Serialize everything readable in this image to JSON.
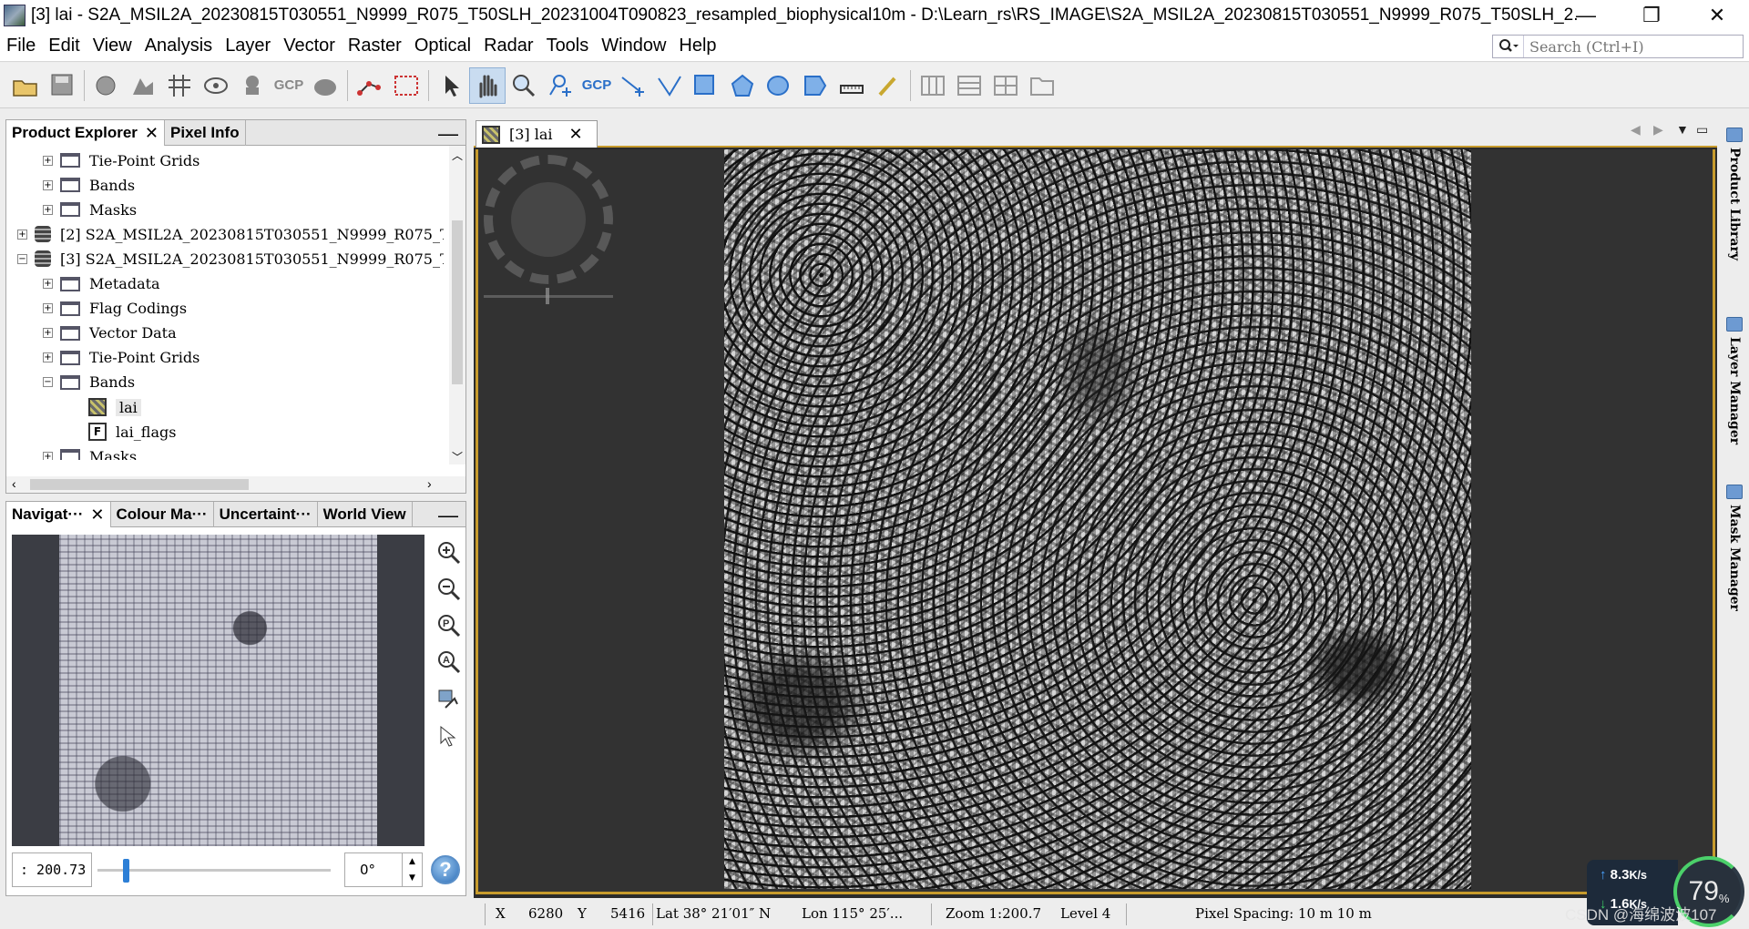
{
  "window": {
    "title": "[3] lai - S2A_MSIL2A_20230815T030551_N9999_R075_T50SLH_20231004T090823_resampled_biophysical10m - D:\\Learn_rs\\RS_IMAGE\\S2A_MSIL2A_20230815T030551_N9999_R075_T50SLH_2...",
    "minimize": "—",
    "restore": "❐",
    "close": "✕"
  },
  "menu": {
    "items": [
      "File",
      "Edit",
      "View",
      "Analysis",
      "Layer",
      "Vector",
      "Raster",
      "Optical",
      "Radar",
      "Tools",
      "Window",
      "Help"
    ],
    "search_placeholder": "Search (Ctrl+I)"
  },
  "toolbar": {
    "gcp_label": "GCP",
    "icons": [
      "open-product-icon",
      "save-product-icon",
      "band-maths-icon",
      "subset-icon",
      "graticule-icon",
      "world-map-icon",
      "gcp-icon",
      "pin-icon",
      "spectrum-icon",
      "pixel-info-icon",
      "select-tool-icon",
      "pan-tool-icon",
      "zoom-tool-icon",
      "pin-placing-icon",
      "gcp-placing-icon",
      "line-drawing-icon",
      "polyline-drawing-icon",
      "rectangle-drawing-icon",
      "polygon-drawing-icon",
      "ellipse-drawing-icon",
      "magic-wand-icon",
      "range-finder-icon",
      "pointer-icon",
      "tile-evenly-icon",
      "tile-horizontal-icon",
      "tile-vertical-icon",
      "tile-single-icon"
    ]
  },
  "product_explorer": {
    "tabs": [
      "Product Explorer",
      "Pixel Info"
    ],
    "minimize": "—",
    "rows": [
      {
        "label": "Tie-Point Grids",
        "exp": "+",
        "kind": "folder"
      },
      {
        "label": "Bands",
        "exp": "+",
        "kind": "folder"
      },
      {
        "label": "Masks",
        "exp": "+",
        "kind": "folder"
      },
      {
        "label": "[2]  S2A_MSIL2A_20230815T030551_N9999_R075_T50S",
        "exp": "+",
        "kind": "product"
      },
      {
        "label": "[3]  S2A_MSIL2A_20230815T030551_N9999_R075_T50S",
        "exp": "−",
        "kind": "product"
      },
      {
        "label": "Metadata",
        "exp": "+",
        "kind": "folder"
      },
      {
        "label": "Flag Codings",
        "exp": "+",
        "kind": "folder"
      },
      {
        "label": "Vector Data",
        "exp": "+",
        "kind": "folder"
      },
      {
        "label": "Tie-Point Grids",
        "exp": "+",
        "kind": "folder"
      },
      {
        "label": "Bands",
        "exp": "−",
        "kind": "folder"
      },
      {
        "label": "lai",
        "exp": "",
        "kind": "band"
      },
      {
        "label": "lai_flags",
        "exp": "",
        "kind": "flag"
      },
      {
        "label": "Masks",
        "exp": "+",
        "kind": "folder"
      }
    ]
  },
  "navigation": {
    "tabs": [
      "Navigat···",
      "Colour Ma···",
      "Uncertaint···",
      "World View"
    ],
    "zoom_value": ": 200.73",
    "rotation_value": "0°",
    "help": "?"
  },
  "image_view": {
    "tab_label": "[3] lai",
    "close": "✕"
  },
  "right_panels": [
    "Product Library",
    "Layer Manager",
    "Mask Manager"
  ],
  "status": {
    "x_label": "X",
    "x_value": "6280",
    "y_label": "Y",
    "y_value": "5416",
    "lat": "Lat 38° 21′01″ N",
    "lon": "Lon 115° 25′...",
    "zoom": "Zoom 1:200.7",
    "level": "Level 4",
    "pixel_spacing": "Pixel Spacing:  10 m 10 m"
  },
  "overlay": {
    "upload_speed": "8.3",
    "upload_unit": "K/s",
    "download_speed": "1.6",
    "download_unit": "K/s",
    "cpu_percent": "79",
    "cpu_unit": "%",
    "watermark": "CSDN @海绵波波107"
  }
}
